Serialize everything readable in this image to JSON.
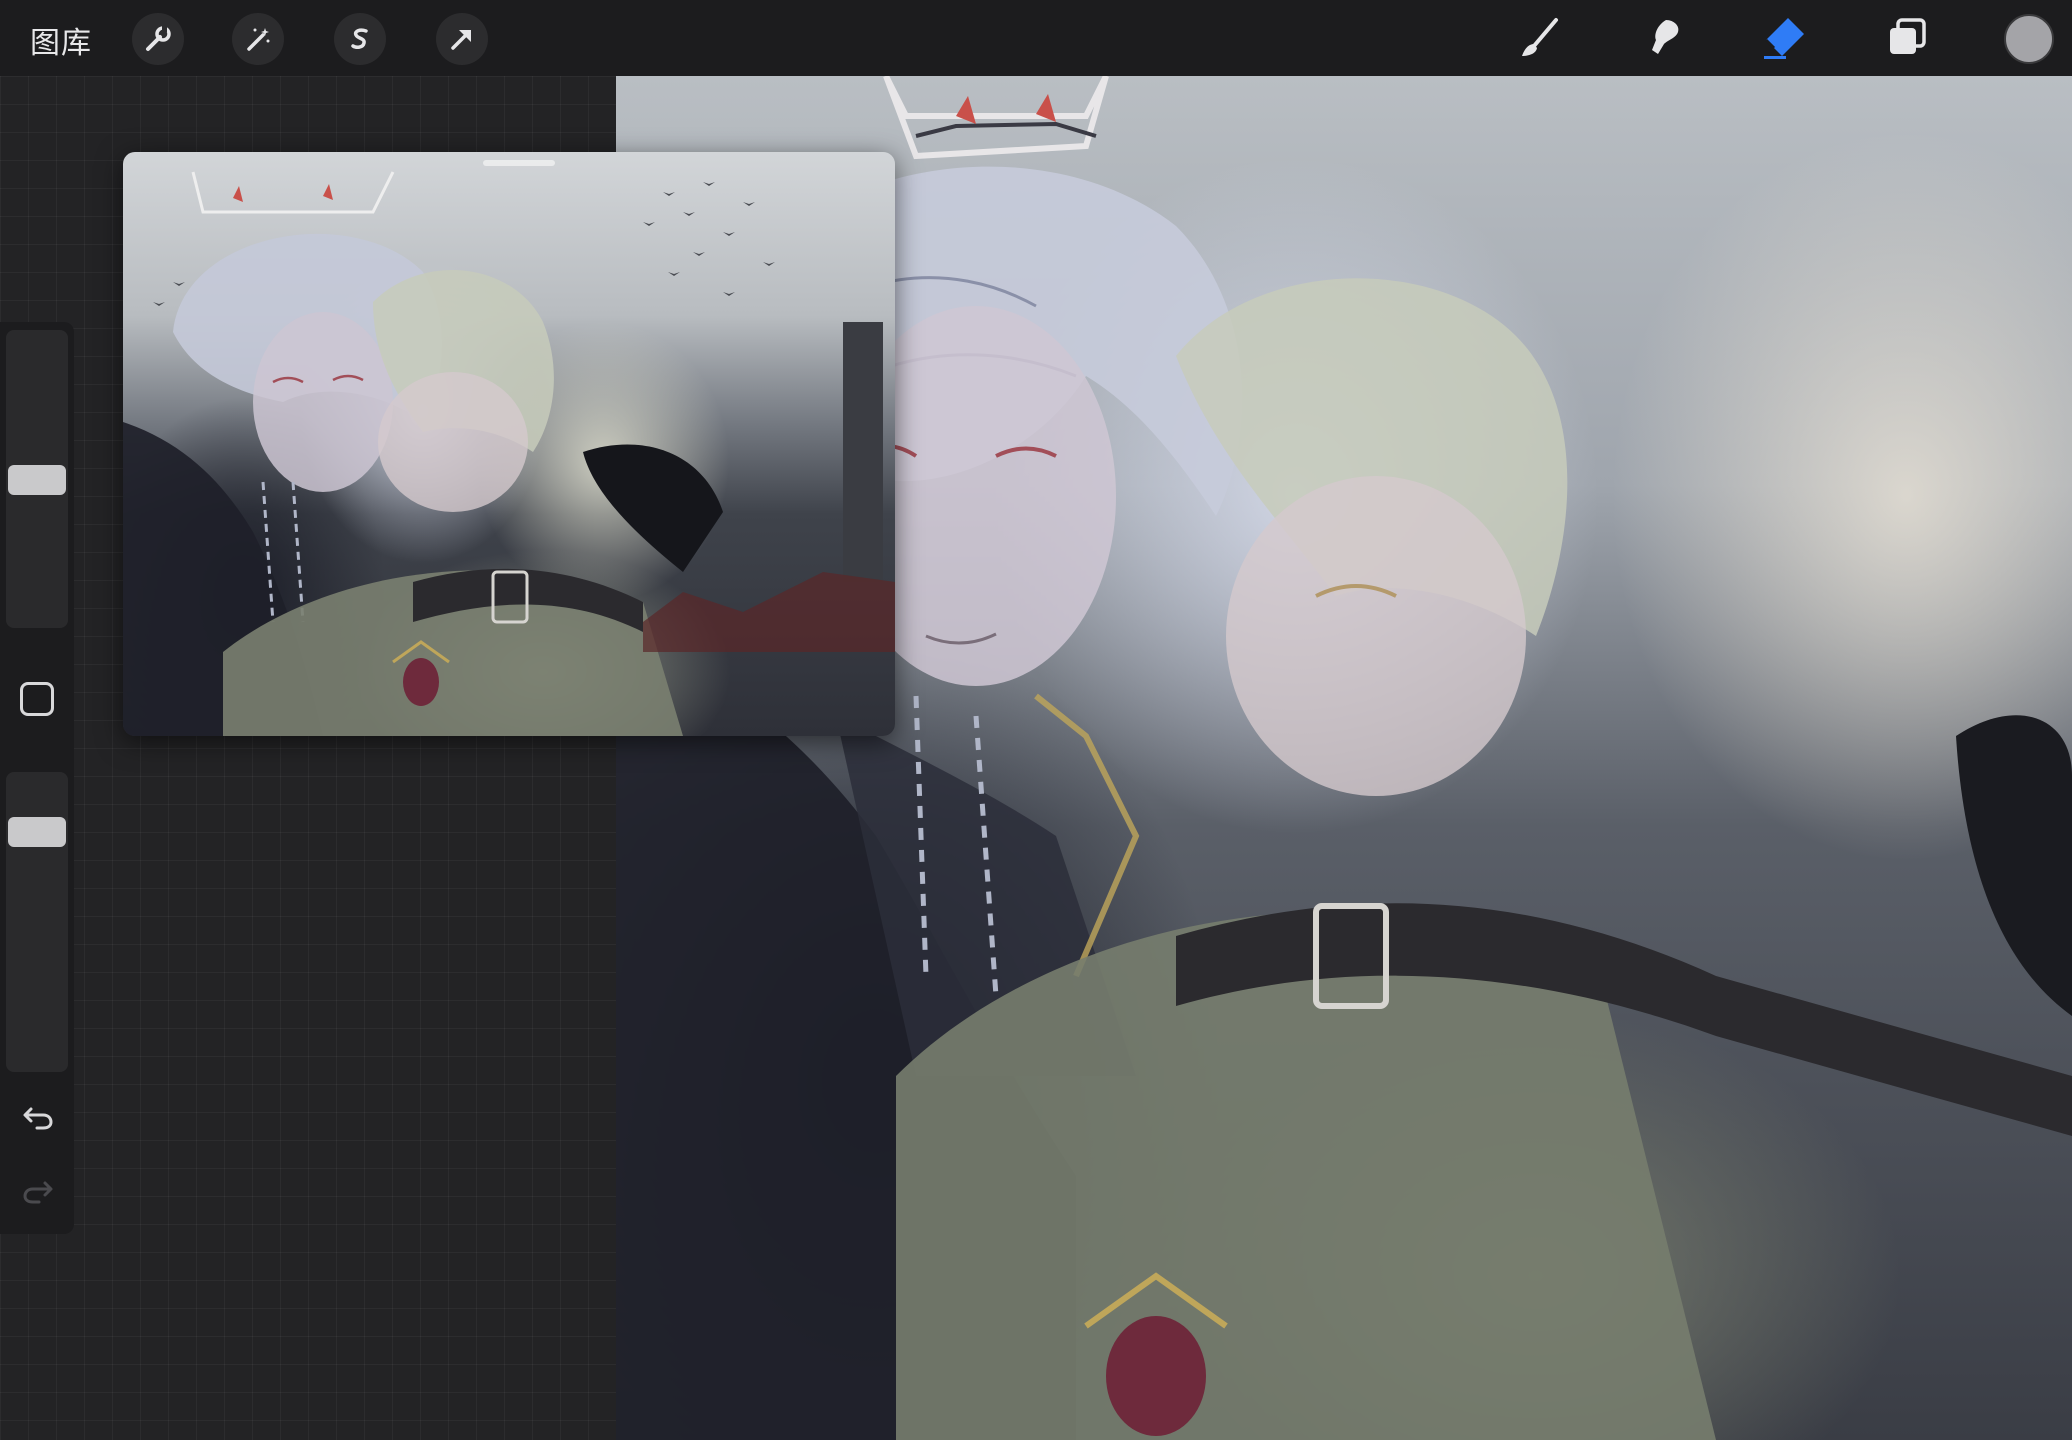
{
  "toolbar": {
    "gallery_label": "图库",
    "left_tools": [
      "wrench-icon",
      "magic-wand-icon",
      "selection-s-icon",
      "transform-arrow-icon"
    ],
    "right_tools": [
      "brush-icon",
      "smudge-icon",
      "eraser-icon",
      "layers-icon"
    ],
    "active_tool": "eraser-icon",
    "accent_color": "#2f7cf6",
    "current_color": "#a4a4a8"
  },
  "sidebar": {
    "brush_size_level": 0.5,
    "opacity_level": 0.85,
    "modify_button": "square-icon",
    "undo": "undo-icon",
    "redo": "redo-icon"
  },
  "reference_window": {
    "visible": true
  }
}
